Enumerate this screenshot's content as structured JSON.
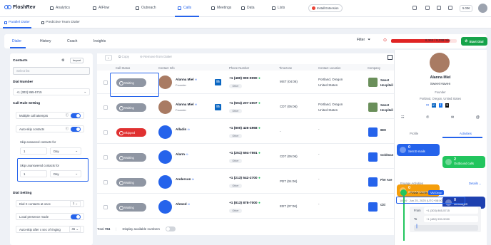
{
  "brand": "FloshRev",
  "nav": [
    "Analytics",
    "AIFlow",
    "Outreach",
    "Calls",
    "Meetings",
    "Data",
    "Lists"
  ],
  "install_extension": "Install Extension",
  "balance": "5.00€",
  "subnav": [
    "Parallel Dialer",
    "Predictive Team Dialer"
  ],
  "tabs": [
    "Dialer",
    "History",
    "Coach",
    "Insights"
  ],
  "filter_label": "Filter",
  "usage_text": "8,344 / 9,338 min",
  "usage_fraction": 0.894,
  "start_dial": "Start Dial",
  "left": {
    "contacts_title": "Contacts",
    "import_label": "Import",
    "contacts_placeholder": "Select list",
    "dial_number_title": "Dial Number",
    "dial_number_value": "+1 (303) 865-5715",
    "call_rule_title": "Call Rule Setting",
    "multiple_attempts": "Multiple call attempts",
    "auto_skip": "Auto-skip contacts",
    "skip_answered": "Skip answered contacts for",
    "skip_answered_value": "1",
    "skip_answered_unit": "Day",
    "skip_unanswered": "Skip unanswered contacts for",
    "skip_unanswered_value": "1",
    "skip_unanswered_unit": "Day",
    "dial_setting_title": "Dial Setting",
    "dial_x": "Dial X contacts at once",
    "dial_x_value": "1",
    "local_presence": "Local presence mode",
    "auto_skip_after": "Auto-skip after x sec of ringing",
    "auto_skip_after_value": "45"
  },
  "toolbar": {
    "copy": "Copy",
    "remove": "Remove from Dialer"
  },
  "columns": [
    "Call Status",
    "Contact Info",
    "Phone Number",
    "Timezone",
    "Contact Location",
    "Company"
  ],
  "rows": [
    {
      "status": "Waiting",
      "name": "Alanna Miel",
      "title": "Founder",
      "phone": "+1 (480) 990-9090",
      "tag": "Other",
      "tz": "MST (04:06)",
      "loc1": "Portland, Oregon",
      "loc2": "United States",
      "company": "Sweet Hospitality"
    },
    {
      "status": "Waiting",
      "name": "Alanna Miel",
      "title": "Founder",
      "phone": "+1 (504) 207-2007",
      "tag": "Other",
      "tz": "CDT (06:06)",
      "loc1": "Portland, Oregon",
      "loc2": "United States",
      "company": "Sweet Hospitality"
    },
    {
      "status": "Skipped",
      "name": "Alladin",
      "title": "",
      "phone": "+1 (800) 426-4968",
      "tag": "Other",
      "tz": "-",
      "loc1": "-",
      "loc2": "",
      "company": "IBM"
    },
    {
      "status": "Waiting",
      "name": "Alarm",
      "title": "",
      "phone": "+1 (251) 694-7591",
      "tag": "Other",
      "tz": "CDT (06:06)",
      "loc1": "-",
      "loc2": "",
      "company": "Goldman"
    },
    {
      "status": "Waiting",
      "name": "Anderson",
      "title": "",
      "phone": "+1 (213) 542-2700",
      "tag": "Other",
      "tz": "PDT (04:06)",
      "loc1": "-",
      "loc2": "",
      "company": "Pier Ave"
    },
    {
      "status": "Waiting",
      "name": "Ahmed",
      "title": "",
      "phone": "+1 (813) 878-7000",
      "tag": "Other",
      "tz": "EDT (07:06)",
      "loc1": "-",
      "loc2": "",
      "company": "Citi"
    }
  ],
  "footer": {
    "total_label": "Total",
    "total": "784",
    "display_label": "Display available numbers"
  },
  "profile": {
    "name": "Alanna Miel",
    "company": "Sweet Haven",
    "title": "Founder",
    "location": "Portland, Oregon, United States",
    "tab_profile": "Profile",
    "tab_activities": "Activities",
    "stats": [
      {
        "count": "0",
        "label": "Sent E-mails",
        "color": "#2563eb"
      },
      {
        "count": "2",
        "label": "Outbound calls",
        "color": "#22c55e"
      },
      {
        "count": "0",
        "label": "Sent Messages",
        "color": "#f59e0b"
      },
      {
        "count": "0",
        "label": "Messages",
        "color": "#1e40af"
      }
    ],
    "engage_label": "Engage Activities",
    "details_label": "Details",
    "activity_title": "Power Dialer",
    "activity_badge": "VM Drop",
    "activity_time": "18:04 · Jun 25, 2025 (UTC+08:00)",
    "from_label": "From",
    "from_value": "+1 (303) 865-5715",
    "to_label": "To",
    "to_value": "+1 (480) 990-9090"
  },
  "colors": {
    "accent": "#2563eb",
    "success": "#16a34a",
    "danger": "#e02424"
  }
}
